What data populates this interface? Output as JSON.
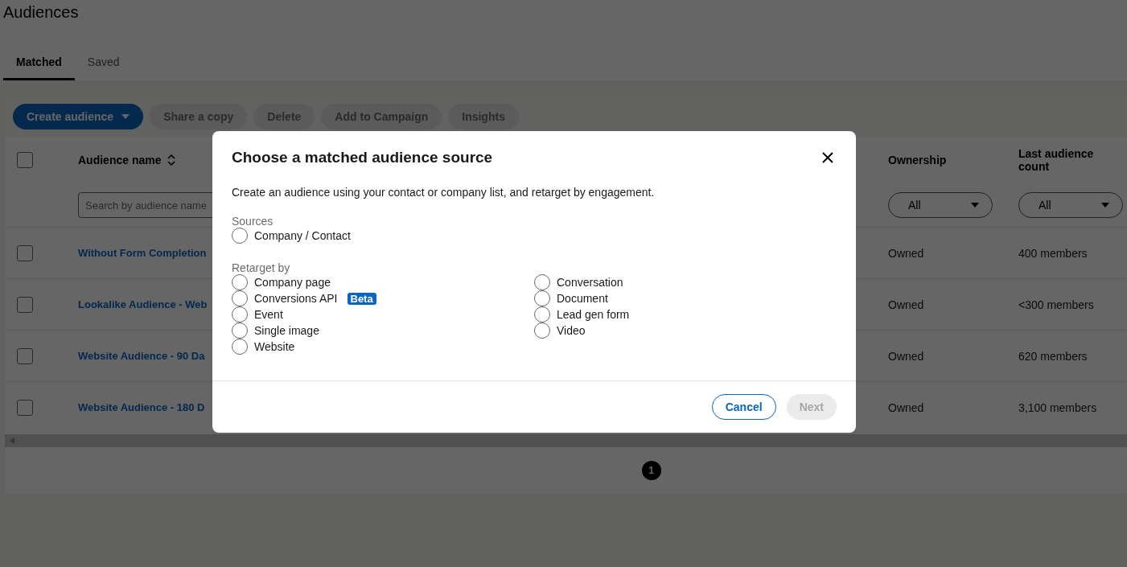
{
  "page": {
    "title": "Audiences"
  },
  "tabs": [
    {
      "label": "Matched",
      "selected": true
    },
    {
      "label": "Saved",
      "selected": false
    }
  ],
  "toolbar": [
    {
      "label": "Create audience",
      "kind": "primary",
      "disabled": false
    },
    {
      "label": "Share a copy",
      "kind": "secondary",
      "disabled": true
    },
    {
      "label": "Delete",
      "kind": "secondary",
      "disabled": true
    },
    {
      "label": "Add to Campaign",
      "kind": "secondary",
      "disabled": true
    },
    {
      "label": "Insights",
      "kind": "secondary",
      "disabled": true
    }
  ],
  "table": {
    "select_all": {
      "checked": false
    },
    "columns": [
      {
        "label": "Audience name",
        "sortable": true,
        "filter": {
          "kind": "search",
          "placeholder": "Search by audience name"
        }
      },
      {
        "label": "Ownership",
        "filter": {
          "kind": "dropdown",
          "value": "All"
        }
      },
      {
        "label": "Last audience count",
        "filter": {
          "kind": "dropdown",
          "value": "All"
        }
      }
    ],
    "rows": [
      {
        "checked": false,
        "name": "Without Form Completion",
        "ownership": "Owned",
        "count": "400 members"
      },
      {
        "checked": false,
        "name": "Lookalike Audience - Web",
        "ownership": "Owned",
        "count": "<300 members"
      },
      {
        "checked": false,
        "name": "Website Audience - 90 Da",
        "ownership": "Owned",
        "count": "620 members"
      },
      {
        "checked": false,
        "name": "Website Audience - 180 D",
        "ownership": "Owned",
        "count": "3,100 members"
      }
    ]
  },
  "pagination": [
    {
      "label": "1",
      "selected": true
    }
  ],
  "dialog": {
    "title": "Choose a matched audience source",
    "description": "Create an audience using your contact or company list, and retarget by engagement.",
    "groups": [
      {
        "label": "Sources",
        "columns": [
          [
            {
              "label": "Company / Contact",
              "selected": false
            }
          ]
        ]
      },
      {
        "label": "Retarget by",
        "columns": [
          [
            {
              "label": "Company page",
              "selected": false
            },
            {
              "label": "Conversions API",
              "badge": "Beta",
              "selected": false
            },
            {
              "label": "Event",
              "selected": false
            },
            {
              "label": "Single image",
              "selected": false
            },
            {
              "label": "Website",
              "selected": false
            }
          ],
          [
            {
              "label": "Conversation",
              "selected": false
            },
            {
              "label": "Document",
              "selected": false
            },
            {
              "label": "Lead gen form",
              "selected": false
            },
            {
              "label": "Video",
              "selected": false
            }
          ]
        ]
      }
    ],
    "buttons": [
      {
        "label": "Cancel",
        "kind": "secondary",
        "disabled": false
      },
      {
        "label": "Next",
        "kind": "primary",
        "disabled": true
      }
    ]
  }
}
